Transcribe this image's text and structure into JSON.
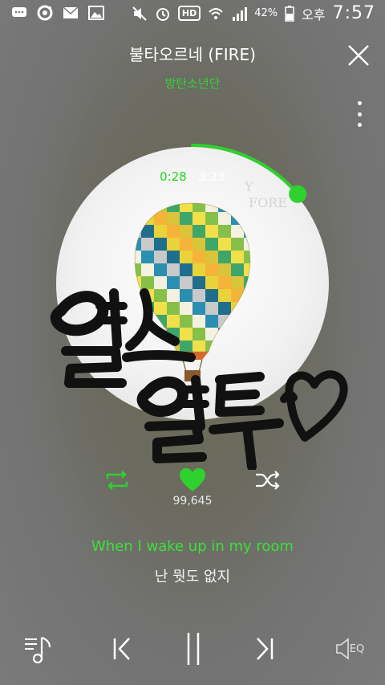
{
  "status_bar": {
    "battery_percent": "42%",
    "ampm": "오후",
    "time": "7:57",
    "hd_label": "HD",
    "icons": [
      "chat-icon",
      "pokeball-icon",
      "mail-icon",
      "image-icon",
      "mute-icon",
      "alarm-icon",
      "hd-icon",
      "wifi-icon",
      "signal-icon",
      "battery-icon"
    ]
  },
  "player": {
    "song_title": "불타오르네 (FIRE)",
    "artist": "방탄소년단",
    "current_time": "0:28",
    "separator": "·",
    "total_time": "3:23",
    "progress_fraction": 0.138,
    "like_count": "99,645",
    "lyric_current": "When I wake up in my room",
    "lyric_next": "난 뭣도 없지"
  },
  "controls": {
    "eq_label": "EQ"
  },
  "colors": {
    "accent": "#2ed12e",
    "text": "#ffffff"
  }
}
